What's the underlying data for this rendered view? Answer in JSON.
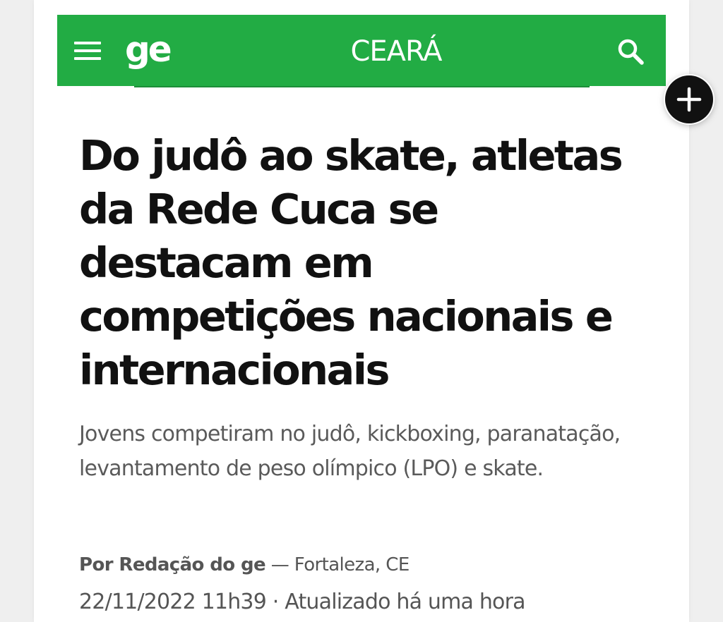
{
  "header": {
    "logo": "ge",
    "section": "CEARÁ",
    "background_color": "#22ac44",
    "menu_icon": "hamburger-menu-icon",
    "search_icon": "search-icon"
  },
  "floating_action": {
    "icon": "plus-icon",
    "background_color": "#111111"
  },
  "article": {
    "headline": "Do judô ao skate, atletas da Rede Cuca se destacam em competições nacionais e internacionais",
    "subtitle": "Jovens competiram no judô, kickboxing, paranatação, levantamento de peso olímpico (LPO) e skate.",
    "author": "Por Redação do ge",
    "location": "— Fortaleza, CE",
    "published": "22/11/2022 11h39",
    "separator": "·",
    "updated": "Atualizado há uma hora"
  }
}
